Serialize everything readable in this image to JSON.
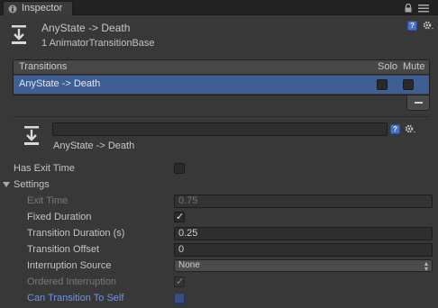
{
  "tab": {
    "label": "Inspector",
    "icon": "info-icon"
  },
  "toolbar_icons": [
    "lock-icon",
    "menu-icon"
  ],
  "header": {
    "title": "AnyState -> Death",
    "subtitle": "1 AnimatorTransitionBase",
    "icon": "transition-icon"
  },
  "transitions": {
    "heading": "Transitions",
    "solo_label": "Solo",
    "mute_label": "Mute",
    "rows": [
      {
        "label": "AnyState -> Death",
        "solo": false,
        "mute": false,
        "selected": true
      }
    ]
  },
  "detail": {
    "name_value": "",
    "label": "AnyState -> Death"
  },
  "properties": {
    "has_exit_time": {
      "label": "Has Exit Time",
      "checked": false
    },
    "settings": {
      "label": "Settings",
      "expanded": true
    },
    "exit_time": {
      "label": "Exit Time",
      "value": "0.75"
    },
    "fixed_duration": {
      "label": "Fixed Duration",
      "checked": true
    },
    "transition_duration": {
      "label": "Transition Duration (s)",
      "value": "0.25"
    },
    "transition_offset": {
      "label": "Transition Offset",
      "value": "0"
    },
    "interruption_source": {
      "label": "Interruption Source",
      "value": "None"
    },
    "ordered_interruption": {
      "label": "Ordered Interruption",
      "checked": true
    },
    "can_transition_to_self": {
      "label": "Can Transition To Self",
      "checked": false
    }
  },
  "colors": {
    "background": "#383838",
    "selection": "#3e5f96",
    "link_blue": "#6f95e0",
    "help_blue": "#4b71c4"
  }
}
